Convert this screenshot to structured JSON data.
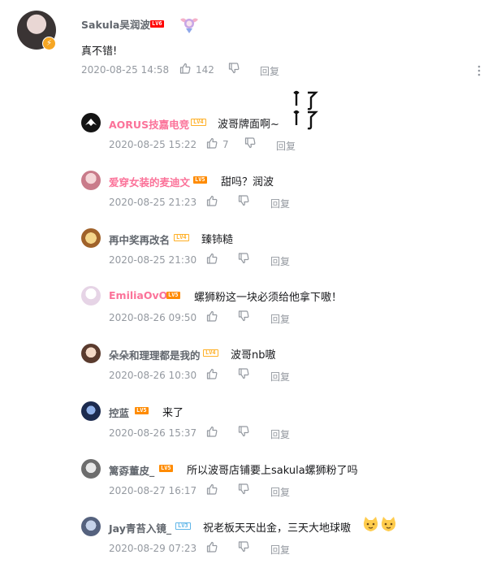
{
  "main": {
    "username": "Sakula吴润波",
    "level": "LV6",
    "text": "真不错!",
    "time": "2020-08-25 14:58",
    "likes": "142",
    "reply_label": "回复"
  },
  "replies": [
    {
      "username": "AORUS技嘉电竞",
      "level": "LV4",
      "text": "波哥牌面啊~",
      "time": "2020-08-25 15:22",
      "likes": "7",
      "reply_label": "回复"
    },
    {
      "username": "爱穿女装的麦迪文",
      "level": "LV5",
      "text": "甜吗？润波",
      "time": "2020-08-25 21:23",
      "likes": "",
      "reply_label": "回复"
    },
    {
      "username": "再中奖再改名",
      "level": "LV4",
      "text": "臻铈糙",
      "time": "2020-08-25 21:30",
      "likes": "",
      "reply_label": "回复"
    },
    {
      "username": "EmiliaOvO",
      "level": "LV5",
      "text": "螺狮粉这一块必须给他拿下嗷！",
      "time": "2020-08-26 09:50",
      "likes": "",
      "reply_label": "回复"
    },
    {
      "username": "朵朵和理理都是我的",
      "level": "LV4",
      "text": "波哥nb嗷",
      "time": "2020-08-26 10:30",
      "likes": "",
      "reply_label": "回复"
    },
    {
      "username": "控蓝",
      "level": "LV5",
      "text": "来了",
      "time": "2020-08-26 15:37",
      "likes": "",
      "reply_label": "回复"
    },
    {
      "username": "篱孬董皮_",
      "level": "LV5",
      "text": "所以波哥店铺要上sakula螺狮粉了吗",
      "time": "2020-08-27 16:17",
      "likes": "",
      "reply_label": "回复"
    },
    {
      "username": "Jay青苔入镜_",
      "level": "LV3",
      "text": "祝老板天天出金，三天大地球嗷",
      "time": "2020-08-29 07:23",
      "likes": "",
      "reply_label": "回复"
    }
  ],
  "colors": {
    "vip_name": "#fb7299",
    "normal_name": "#61666d",
    "meta": "#9499a0"
  },
  "icons": {
    "like": "thumbs-up-icon",
    "dislike": "thumbs-down-icon",
    "more": "more-vertical-icon",
    "medal": "angel-medal-icon",
    "emoji": "cat-face-emoji"
  }
}
